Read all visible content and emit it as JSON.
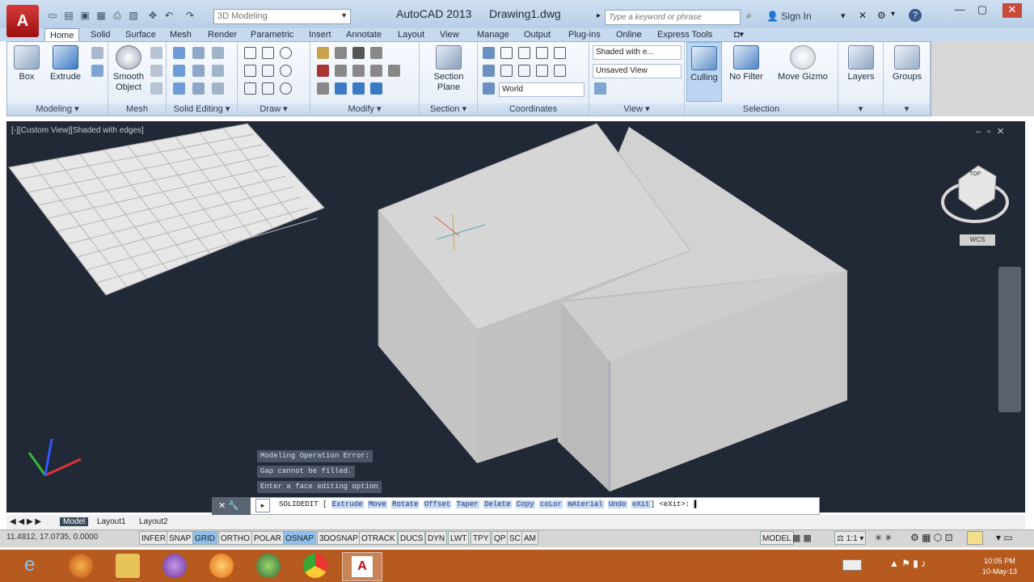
{
  "app": {
    "title": "AutoCAD 2013",
    "document": "Drawing1.dwg",
    "logo": "A"
  },
  "workspace": {
    "value": "3D Modeling"
  },
  "search": {
    "placeholder": "Type a keyword or phrase"
  },
  "signin": {
    "label": "Sign In"
  },
  "tabs": [
    {
      "label": "Home"
    },
    {
      "label": "Solid"
    },
    {
      "label": "Surface"
    },
    {
      "label": "Mesh"
    },
    {
      "label": "Render"
    },
    {
      "label": "Parametric"
    },
    {
      "label": "Insert"
    },
    {
      "label": "Annotate"
    },
    {
      "label": "Layout"
    },
    {
      "label": "View"
    },
    {
      "label": "Manage"
    },
    {
      "label": "Output"
    },
    {
      "label": "Plug-ins"
    },
    {
      "label": "Online"
    },
    {
      "label": "Express Tools"
    }
  ],
  "ribbon": {
    "panels": {
      "modeling": "Modeling ▾",
      "mesh": "Mesh",
      "solid_editing": "Solid Editing ▾",
      "draw": "Draw ▾",
      "modify": "Modify ▾",
      "section": "Section ▾",
      "coordinates": "Coordinates",
      "view": "View ▾",
      "selection": "Selection"
    },
    "buttons": {
      "box": "Box",
      "extrude": "Extrude",
      "smooth": "Smooth\nObject",
      "section_plane": "Section\nPlane",
      "culling": "Culling",
      "no_filter": "No Filter",
      "move_gizmo": "Move Gizmo",
      "layers": "Layers",
      "groups": "Groups"
    },
    "dropdowns": {
      "visual_style": "Shaded with e...",
      "named_view": "Unsaved View",
      "ucs": "World"
    }
  },
  "viewport": {
    "label": "[-][Custom View][Shaded with edges]",
    "wcs": "WCS",
    "cube_top": "TOP"
  },
  "command_history": [
    "Modeling Operation Error:",
    "  Gap cannot be filled.",
    "Enter a face editing option"
  ],
  "command": {
    "name": "SOLIDEDIT",
    "options": [
      "Extrude",
      "Move",
      "Rotate",
      "Offset",
      "Taper",
      "Delete",
      "Copy",
      "coLor",
      "mAterial",
      "Undo",
      "eXit"
    ],
    "suffix": "<eXit>:"
  },
  "layout_tabs": [
    "Model",
    "Layout1",
    "Layout2"
  ],
  "status": {
    "coords": "11.4812, 17.0735, 0.0000",
    "buttons": [
      {
        "label": "INFER",
        "on": false
      },
      {
        "label": "SNAP",
        "on": false
      },
      {
        "label": "GRID",
        "on": true
      },
      {
        "label": "ORTHO",
        "on": false
      },
      {
        "label": "POLAR",
        "on": false
      },
      {
        "label": "OSNAP",
        "on": true
      },
      {
        "label": "3DOSNAP",
        "on": false
      },
      {
        "label": "OTRACK",
        "on": false
      },
      {
        "label": "DUCS",
        "on": false
      },
      {
        "label": "DYN",
        "on": false
      },
      {
        "label": "LWT",
        "on": false
      },
      {
        "label": "TPY",
        "on": false
      },
      {
        "label": "QP",
        "on": false
      },
      {
        "label": "SC",
        "on": false
      },
      {
        "label": "AM",
        "on": false
      }
    ],
    "model": "MODEL",
    "scale": "1:1"
  },
  "clock": {
    "time": "10:05 PM",
    "date": "10-May-13"
  },
  "colors": {
    "viewport": "#212836",
    "solid": "#c9c9c9",
    "taskbar": "#b65a1f"
  }
}
